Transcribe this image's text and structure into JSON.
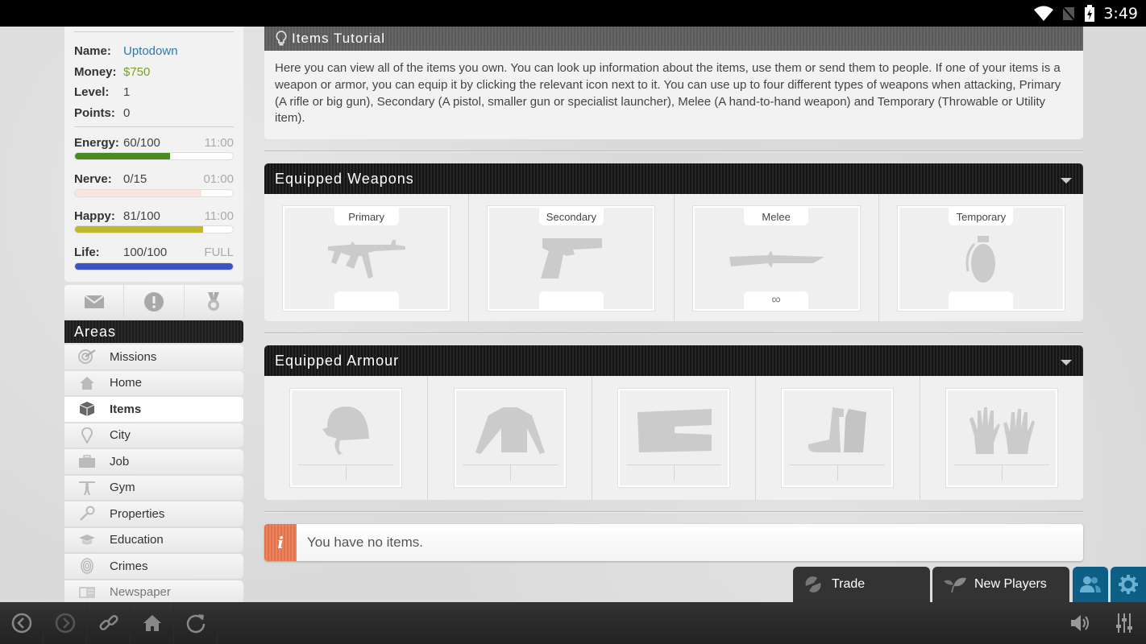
{
  "status_bar": {
    "time": "3:49",
    "icons": [
      "wifi-icon",
      "no-signal-icon",
      "battery-charging-icon"
    ]
  },
  "user": {
    "fields": [
      {
        "key": "Name:",
        "value": "Uptodown"
      },
      {
        "key": "Money:",
        "value": "$750"
      },
      {
        "key": "Level:",
        "value": "1"
      },
      {
        "key": "Points:",
        "value": "0"
      }
    ],
    "bars": [
      {
        "key": "Energy:",
        "value": "60/100",
        "timer": "11:00",
        "fill": 0.6,
        "color": "#4a8a22"
      },
      {
        "key": "Nerve:",
        "value": "0/15",
        "timer": "01:00",
        "fill": 0.0,
        "color": "#f9dcd6"
      },
      {
        "key": "Happy:",
        "value": "81/100",
        "timer": "11:00",
        "fill": 0.81,
        "color": "#c2b82c"
      },
      {
        "key": "Life:",
        "value": "100/100",
        "timer": "FULL",
        "fill": 1.0,
        "color": "#3d52c4"
      }
    ]
  },
  "quick_icons": [
    "mail-icon",
    "alert-icon",
    "medal-icon"
  ],
  "areas": {
    "title": "Areas",
    "items": [
      {
        "label": "Missions",
        "icon": "target-icon"
      },
      {
        "label": "Home",
        "icon": "home-icon"
      },
      {
        "label": "Items",
        "icon": "box-icon",
        "active": true
      },
      {
        "label": "City",
        "icon": "map-pin-icon"
      },
      {
        "label": "Job",
        "icon": "briefcase-icon"
      },
      {
        "label": "Gym",
        "icon": "weightlifter-icon"
      },
      {
        "label": "Properties",
        "icon": "key-icon"
      },
      {
        "label": "Education",
        "icon": "graduation-cap-icon"
      },
      {
        "label": "Crimes",
        "icon": "fingerprint-icon"
      },
      {
        "label": "Newspaper",
        "icon": "newspaper-icon"
      }
    ]
  },
  "tutorial": {
    "title": "Items Tutorial",
    "text": "Here you can view all of the items you own. You can look up information about the items, use them or send them to people. If one of your items is a weapon or armor, you can equip it by clicking the relevant icon next to it. You can use up to four different types of weapons when attacking, Primary (A rifle or big gun), Secondary (A pistol, smaller gun or specialist launcher), Melee (A hand-to-hand weapon) and Temporary (Throwable or Utility item)."
  },
  "weapons": {
    "title": "Equipped Weapons",
    "slots": [
      {
        "label": "Primary",
        "icon": "rifle-icon",
        "footer": ""
      },
      {
        "label": "Secondary",
        "icon": "pistol-icon",
        "footer": ""
      },
      {
        "label": "Melee",
        "icon": "knife-icon",
        "footer": "∞"
      },
      {
        "label": "Temporary",
        "icon": "grenade-icon",
        "footer": ""
      }
    ]
  },
  "armour": {
    "title": "Equipped Armour",
    "slots": [
      {
        "icon": "helmet-icon"
      },
      {
        "icon": "jacket-icon"
      },
      {
        "icon": "pants-icon"
      },
      {
        "icon": "boots-icon"
      },
      {
        "icon": "gloves-icon"
      }
    ]
  },
  "message": {
    "text": "You have no items.",
    "icon": "info-icon"
  },
  "bottom_tabs": {
    "trade": "Trade",
    "new_players": "New Players"
  },
  "accent": {
    "blue": "#0d5f86",
    "info": "#e2724a"
  }
}
